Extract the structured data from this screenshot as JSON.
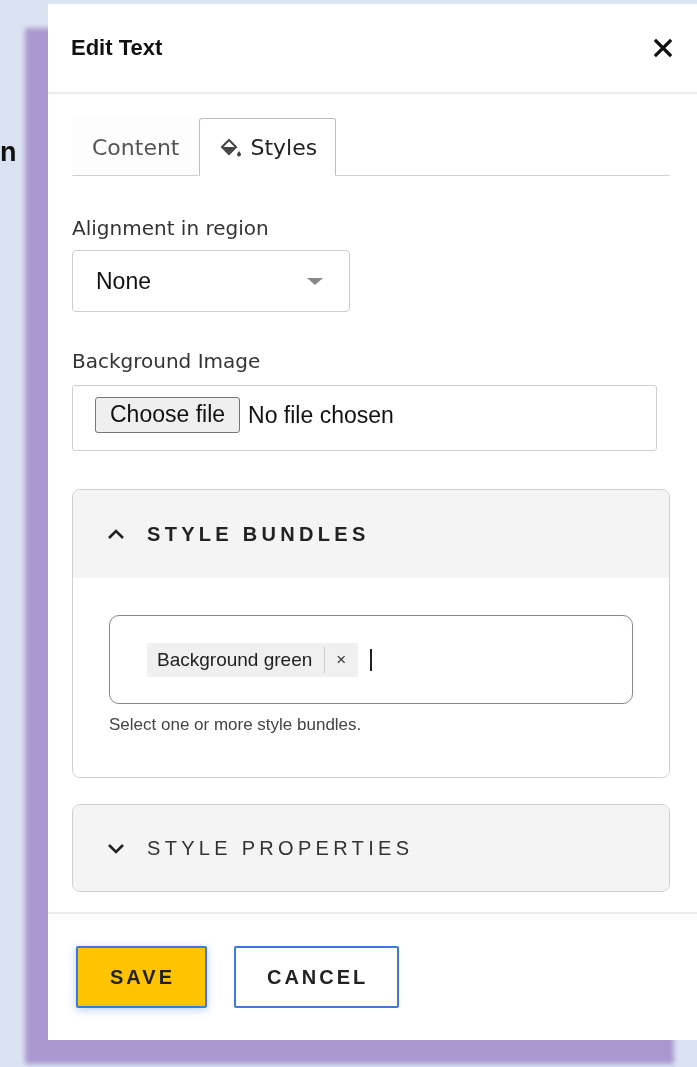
{
  "background_text": "n",
  "dialog": {
    "title": "Edit Text",
    "tabs": [
      {
        "label": "Content",
        "selected": false,
        "has_icon": false
      },
      {
        "label": "Styles",
        "selected": true,
        "has_icon": true
      }
    ],
    "alignment": {
      "label": "Alignment in region",
      "value": "None"
    },
    "background_image": {
      "label": "Background Image",
      "button": "Choose file",
      "status": "No file chosen"
    },
    "sections": [
      {
        "title": "STYLE BUNDLES",
        "expanded": true,
        "tags": [
          {
            "label": "Background green",
            "remove": "×"
          }
        ],
        "help": "Select one or more style bundles."
      },
      {
        "title": "STYLE PROPERTIES",
        "expanded": false
      }
    ],
    "buttons": [
      {
        "label": "SAVE",
        "kind": "primary"
      },
      {
        "label": "CANCEL",
        "kind": "secondary"
      }
    ]
  }
}
